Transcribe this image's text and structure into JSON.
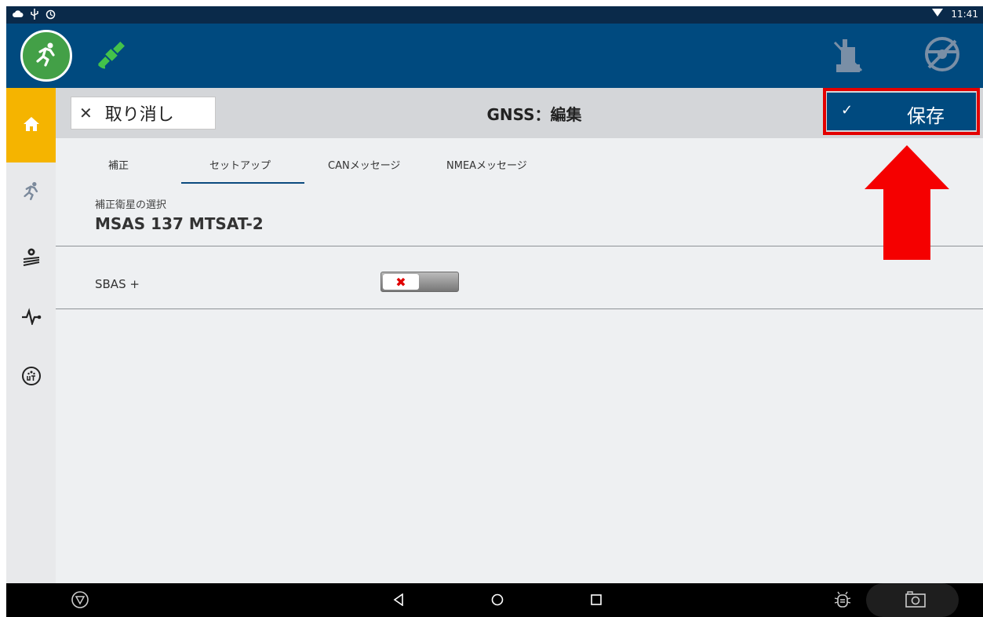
{
  "status_bar": {
    "time": "11:41"
  },
  "edit_header": {
    "cancel_label": "取り消し",
    "title": "GNSS：編集",
    "save_label": "保存"
  },
  "tabs": [
    {
      "label": "補正"
    },
    {
      "label": "セットアップ",
      "selected": true
    },
    {
      "label": "CANメッセージ"
    },
    {
      "label": "NMEAメッセージ"
    }
  ],
  "correction_satellite": {
    "label": "補正衛星の選択",
    "value": "MSAS 137 MTSAT-2"
  },
  "sbas_plus": {
    "label": "SBAS +",
    "enabled": false
  },
  "colors": {
    "header_blue": "#004a7f",
    "status_bar": "#0a2a4a",
    "active_sidebar": "#f5b400",
    "highlight_red": "#e30000",
    "run_green": "#43a047"
  },
  "icons": {
    "statusbar": [
      "cloud-icon",
      "usb-icon",
      "sync-icon",
      "wifi-icon"
    ],
    "appbar": [
      "run-icon",
      "gnss-satellite-icon",
      "implement-disabled-icon",
      "steering-disabled-icon"
    ],
    "sidebar": [
      "home-icon",
      "run-icon",
      "field-settings-icon",
      "diagnostics-icon",
      "ut-icon"
    ],
    "navbar": [
      "menu-icon",
      "back-icon",
      "home-circle-icon",
      "recents-icon",
      "bug-icon",
      "camera-icon"
    ]
  }
}
